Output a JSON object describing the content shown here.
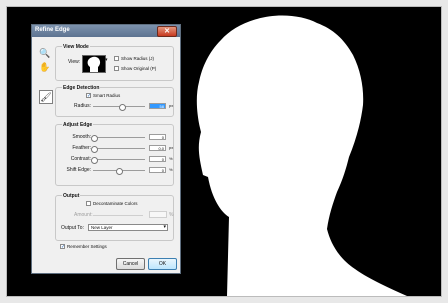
{
  "dialog": {
    "title": "Refine Edge",
    "close_glyph": "✕",
    "tools": [
      {
        "name": "zoom-icon",
        "glyph": "🔍"
      },
      {
        "name": "hand-icon",
        "glyph": "✋"
      },
      {
        "name": "refine-brush-icon",
        "glyph": "🖌"
      }
    ],
    "view_mode": {
      "title": "View Mode",
      "view_label": "View:",
      "dropdown_glyph": "▾",
      "show_radius": {
        "label": "Show Radius (J)",
        "checked": false
      },
      "show_original": {
        "label": "Show Original (P)",
        "checked": false
      }
    },
    "edge_detection": {
      "title": "Edge Detection",
      "smart_radius": {
        "label": "Smart Radius",
        "checked": true
      },
      "radius": {
        "label": "Radius:",
        "value": "58",
        "unit": "px",
        "level": 0.55
      }
    },
    "adjust_edge": {
      "title": "Adjust Edge",
      "smooth": {
        "label": "Smooth:",
        "value": "0",
        "unit": "",
        "level": 0
      },
      "feather": {
        "label": "Feather:",
        "value": "0.0",
        "unit": "px",
        "level": 0
      },
      "contrast": {
        "label": "Contrast:",
        "value": "0",
        "unit": "%",
        "level": 0
      },
      "shift_edge": {
        "label": "Shift Edge:",
        "value": "0",
        "unit": "%",
        "level": 0.5
      }
    },
    "output": {
      "title": "Output",
      "decontaminate": {
        "label": "Decontaminate Colors",
        "checked": false
      },
      "amount_label": "Amount:",
      "amount_unit": "%",
      "output_to_label": "Output To:",
      "output_to_value": "New Layer"
    },
    "remember_settings": {
      "label": "Remember Settings",
      "checked": true
    },
    "cancel_label": "Cancel",
    "ok_label": "OK",
    "check_glyph": "✓"
  },
  "colors": {
    "background": "#000000",
    "mask": "#ffffff",
    "titlebar": "#5d7391",
    "close": "#c6381e"
  }
}
